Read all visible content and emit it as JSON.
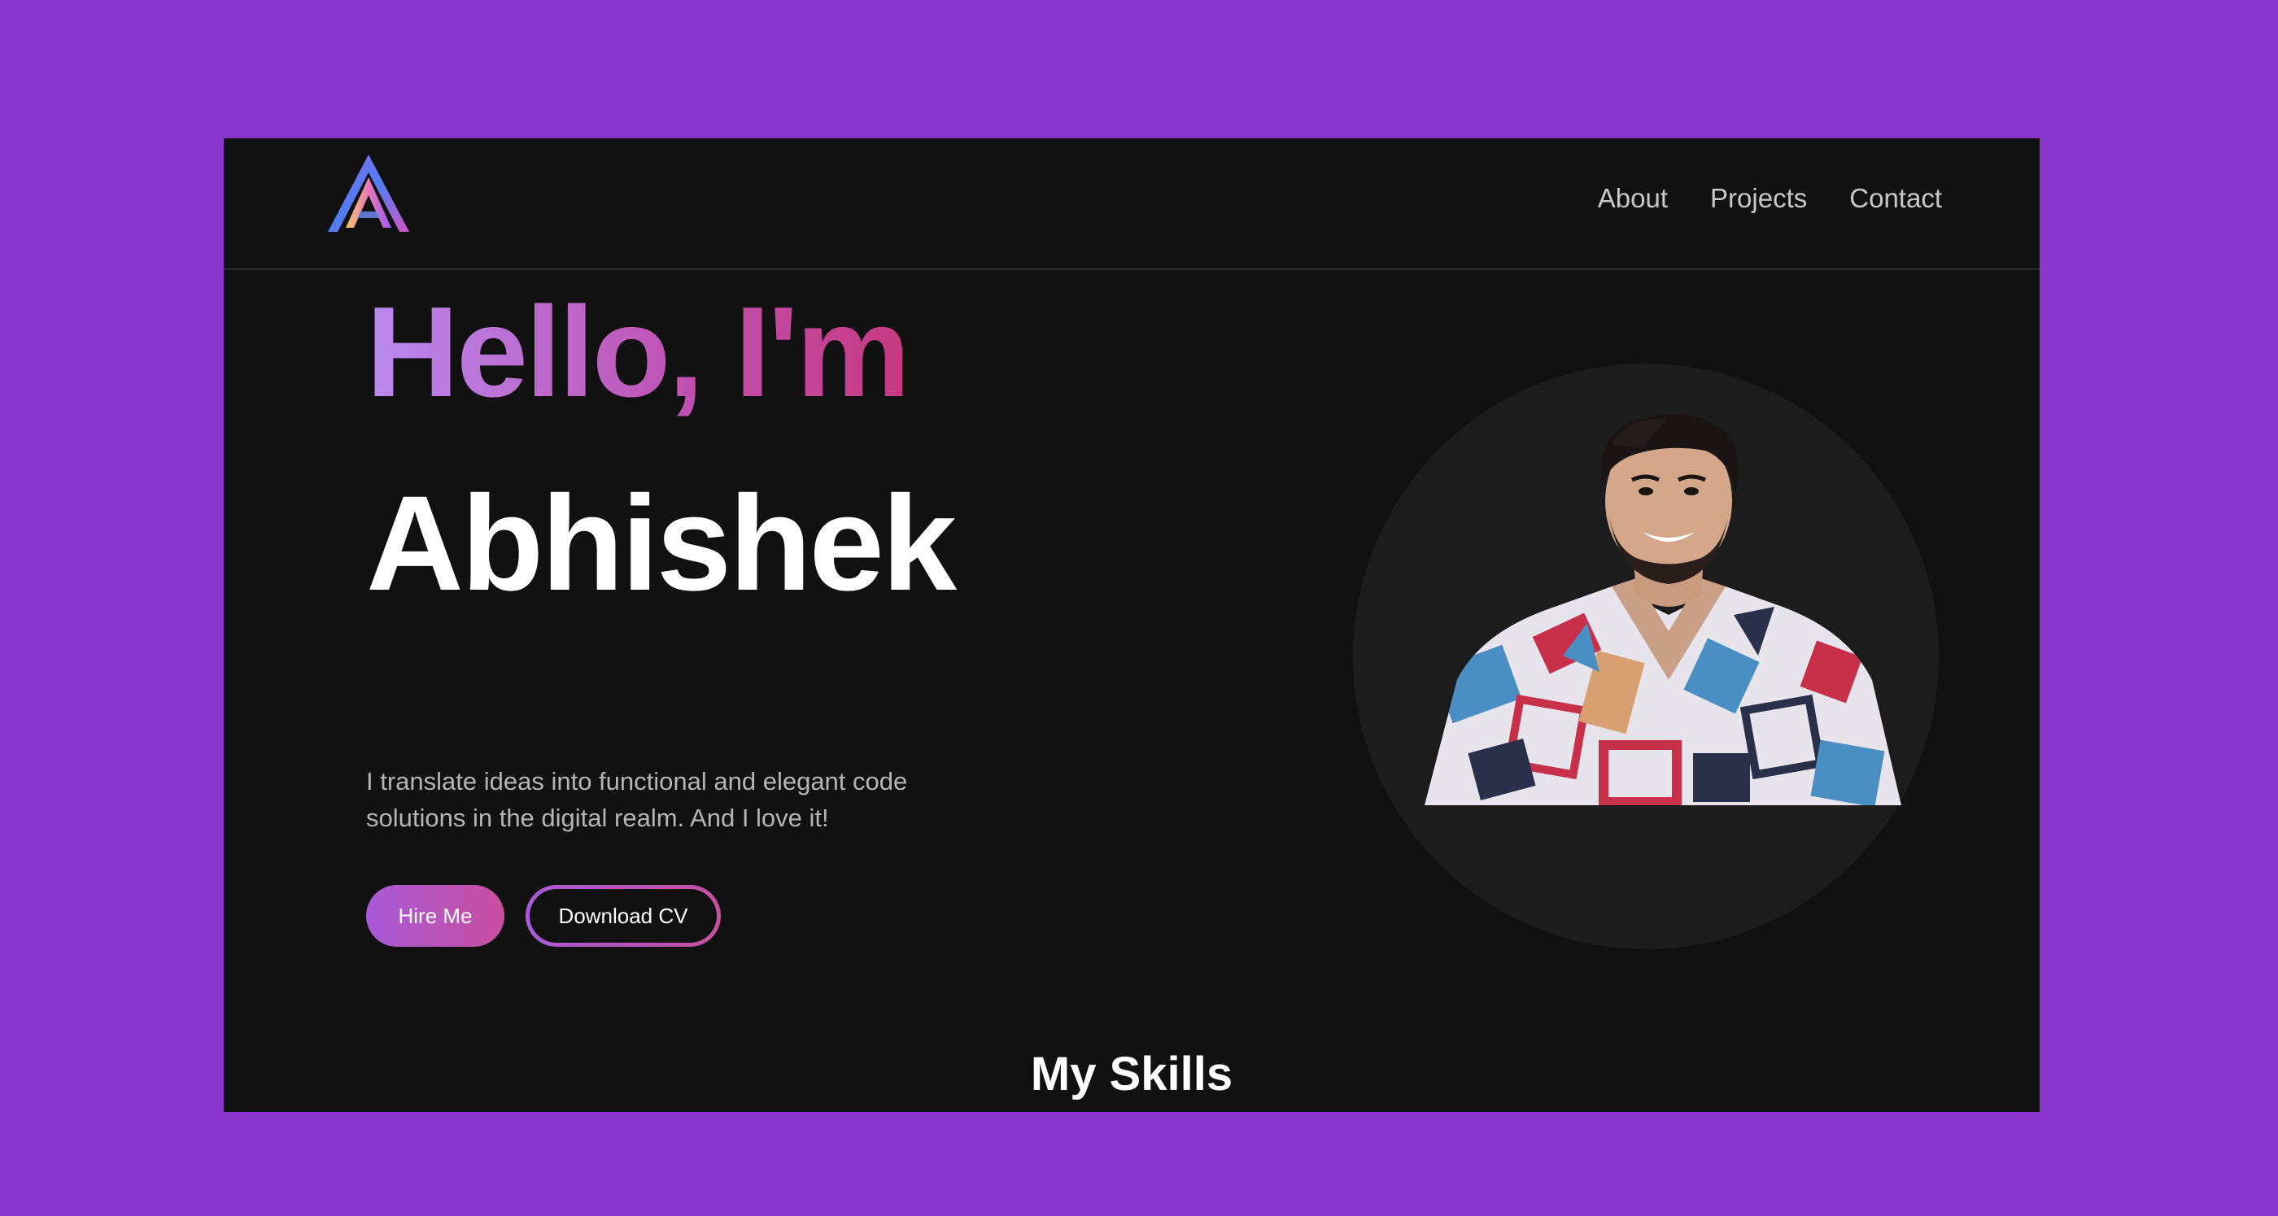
{
  "nav": {
    "logo_icon": "gradient-triangle-a-logo-icon",
    "links": [
      "About",
      "Projects",
      "Contact"
    ]
  },
  "hero": {
    "greeting": "Hello, I'm",
    "name": "Abhishek",
    "tagline": "I translate ideas into functional and elegant code solutions in the digital realm. And I love it!",
    "hire_label": "Hire Me",
    "cv_label": "Download CV",
    "photo_icon": "profile-photo"
  },
  "skills": {
    "heading": "My Skills"
  },
  "colors": {
    "page_background": "#8936cf",
    "frame_background": "#111111",
    "accent_start": "#a85ad8",
    "accent_end": "#c84f9e",
    "text_primary": "#ffffff",
    "text_muted": "#b5b5b5"
  }
}
